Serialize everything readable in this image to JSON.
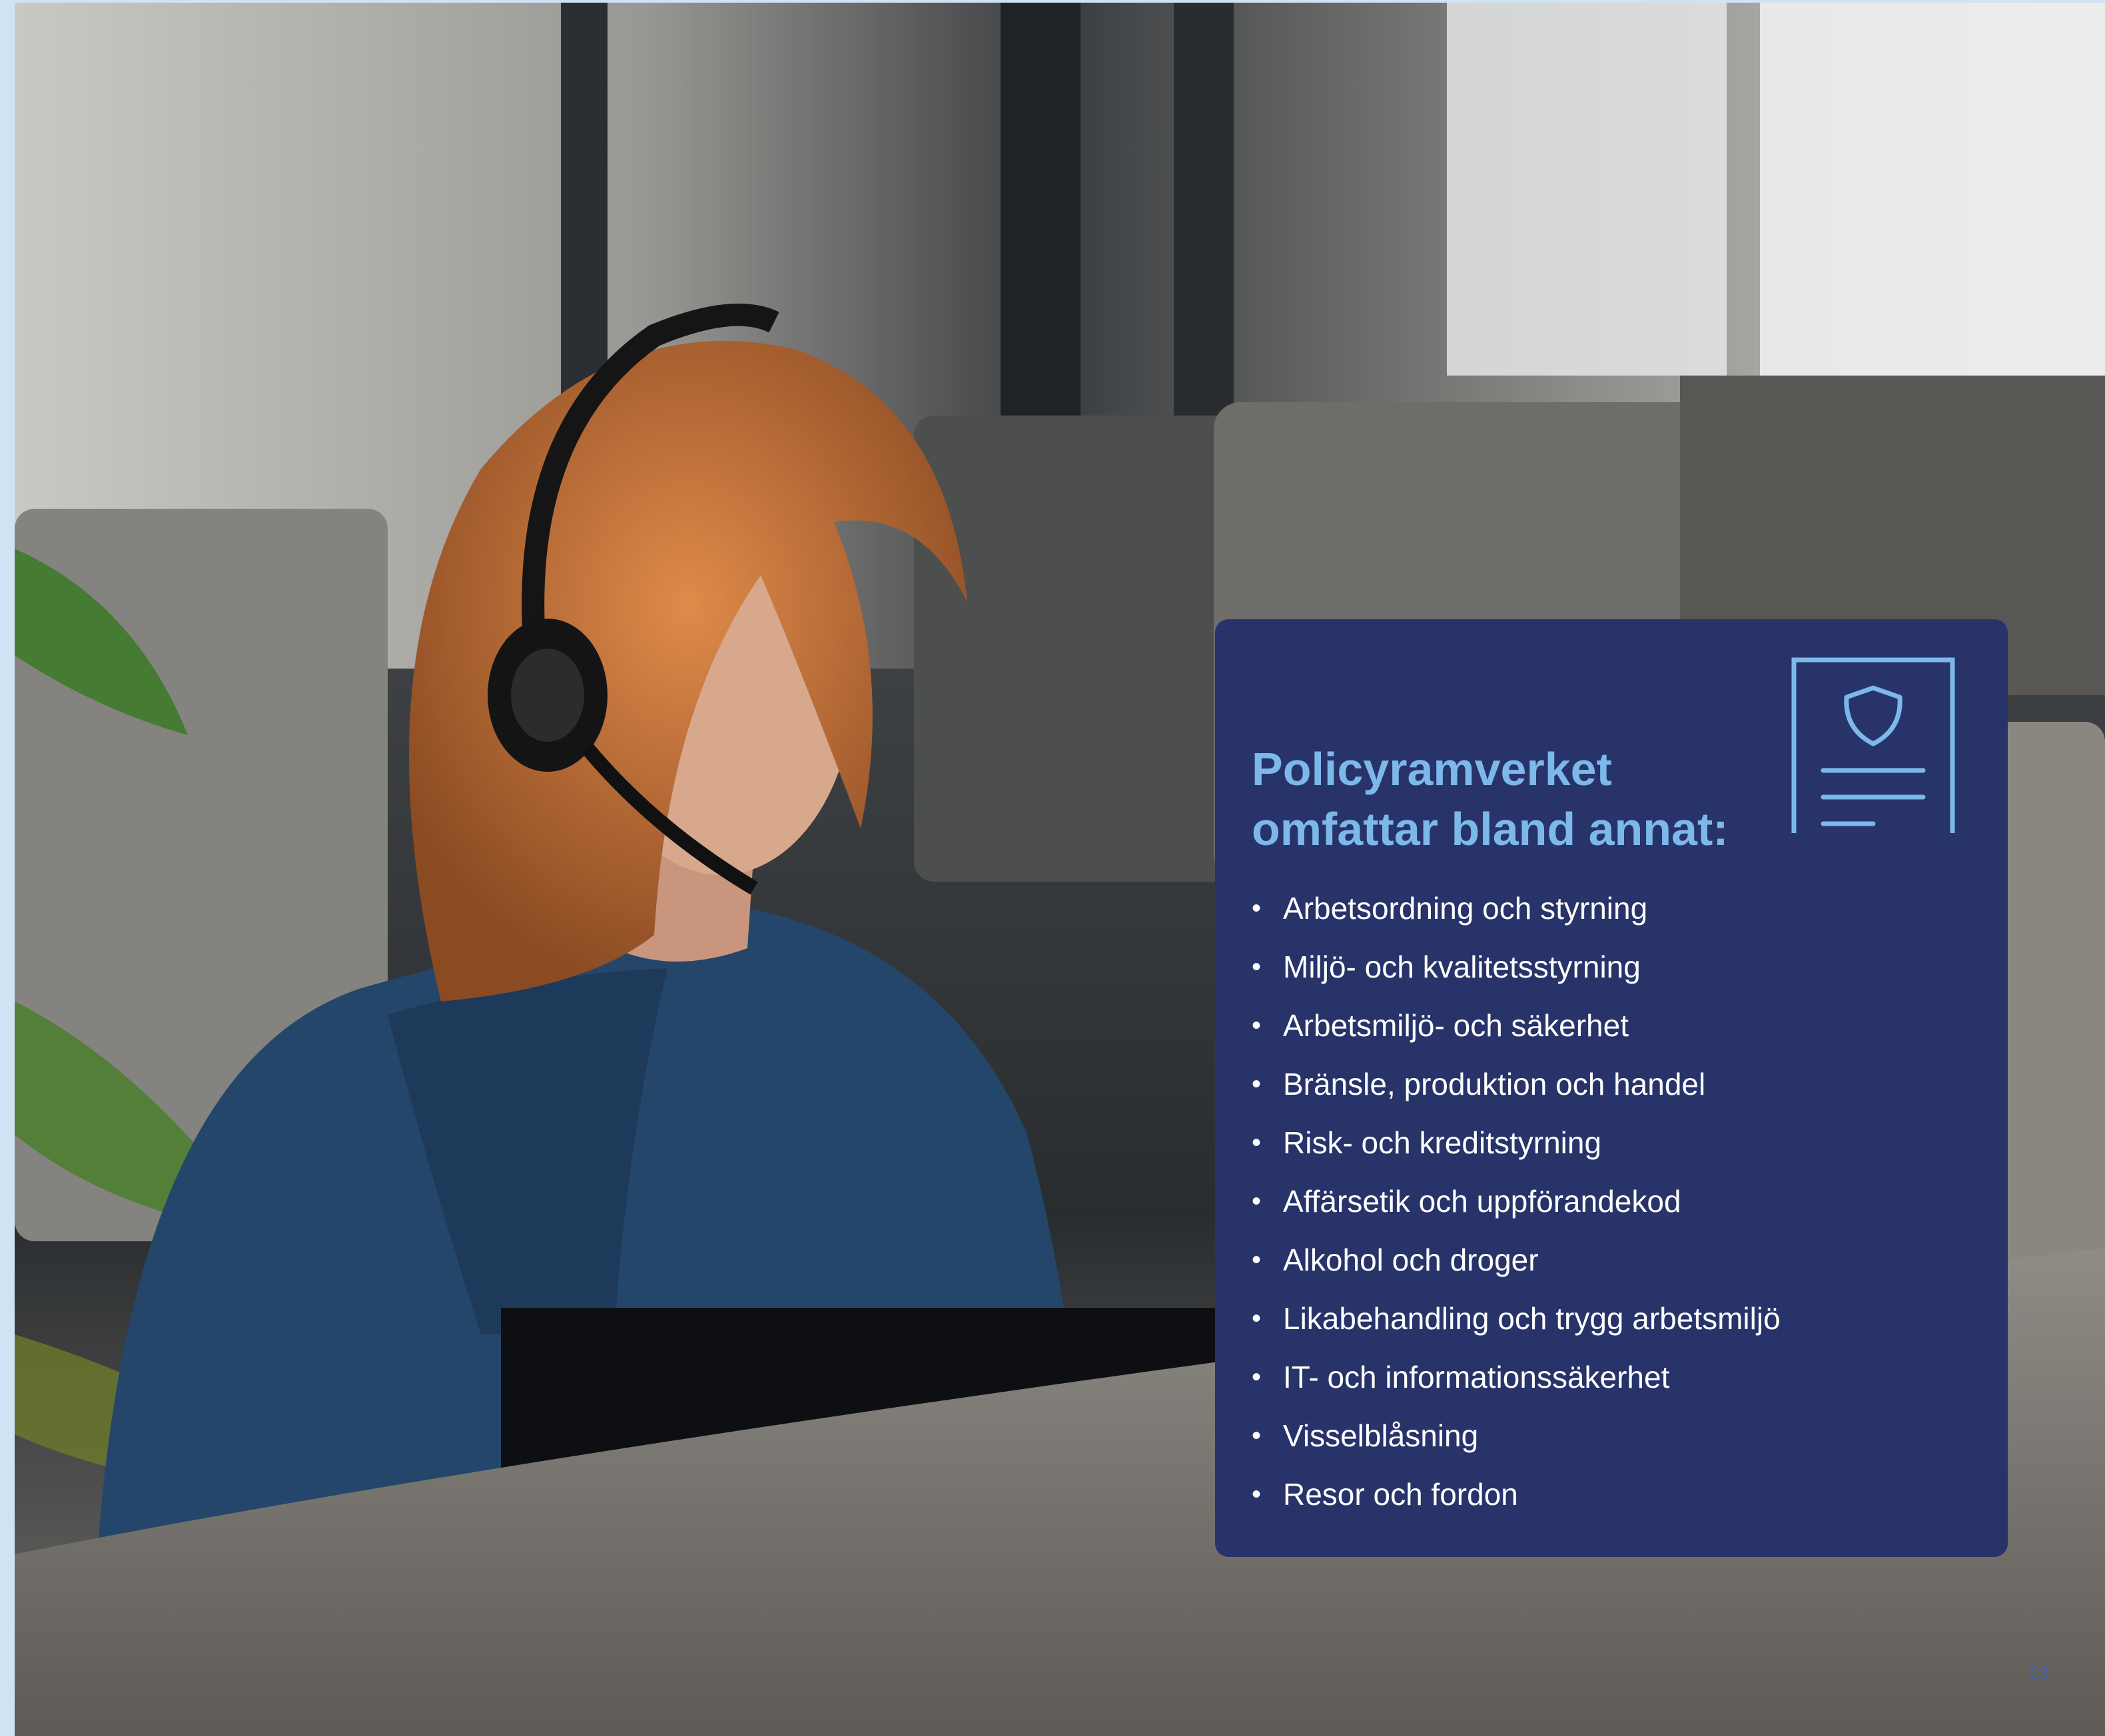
{
  "card": {
    "heading_line1": "Policyramverket",
    "heading_line2": "omfattar bland annat:",
    "items": [
      "Arbetsordning och styrning",
      "Miljö- och kvalitetsstyrning",
      "Arbetsmiljö- och säkerhet",
      "Bränsle, produktion och handel",
      "Risk- och kreditstyrning",
      "Affärsetik och uppförandekod",
      "Alkohol och droger",
      "Likabehandling och trygg arbetsmiljö",
      "IT- och informationssäkerhet",
      "Visselblåsning",
      "Resor och fordon"
    ],
    "icon": "document-shield-icon",
    "colors": {
      "background": "#273369",
      "heading": "#7db8ea",
      "icon": "#7db8ea",
      "text": "#ffffff"
    }
  },
  "photo": {
    "icon": "office-worker-headset-photo"
  },
  "page": {
    "number": "13"
  },
  "colors": {
    "accent_strip": "#cfe3f5",
    "page_number": "#4a5fa8"
  }
}
